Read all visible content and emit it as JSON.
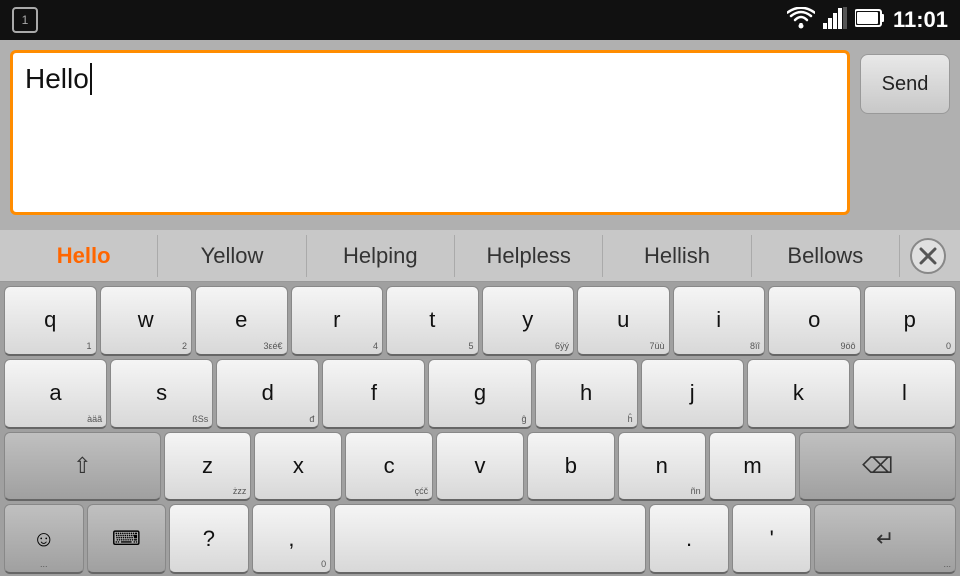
{
  "status_bar": {
    "notification": "1",
    "time": "11:01"
  },
  "message_area": {
    "input_text": "Hello",
    "send_button_label": "Send"
  },
  "suggestions": [
    {
      "label": "Hello",
      "active": true
    },
    {
      "label": "Yellow",
      "active": false
    },
    {
      "label": "Helping",
      "active": false
    },
    {
      "label": "Helpless",
      "active": false
    },
    {
      "label": "Hellish",
      "active": false
    },
    {
      "label": "Bellows",
      "active": false
    }
  ],
  "keyboard": {
    "rows": [
      [
        {
          "main": "q",
          "sub": "1"
        },
        {
          "main": "w",
          "sub": "2"
        },
        {
          "main": "e",
          "sub": "3εé€"
        },
        {
          "main": "r",
          "sub": "4"
        },
        {
          "main": "t",
          "sub": "5"
        },
        {
          "main": "y",
          "sub": "6ÿý"
        },
        {
          "main": "u",
          "sub": "7üù"
        },
        {
          "main": "i",
          "sub": "8ïî"
        },
        {
          "main": "o",
          "sub": "9öô"
        },
        {
          "main": "p",
          "sub": "0"
        }
      ],
      [
        {
          "main": "a",
          "sub": "àäã"
        },
        {
          "main": "s",
          "sub": "ßSs"
        },
        {
          "main": "d",
          "sub": "đ"
        },
        {
          "main": "f",
          "sub": ""
        },
        {
          "main": "g",
          "sub": "ĝ"
        },
        {
          "main": "h",
          "sub": "ĥ"
        },
        {
          "main": "j",
          "sub": ""
        },
        {
          "main": "k",
          "sub": ""
        },
        {
          "main": "l",
          "sub": ""
        }
      ],
      [
        {
          "main": "shift",
          "sub": ""
        },
        {
          "main": "z",
          "sub": "żzz"
        },
        {
          "main": "x",
          "sub": ""
        },
        {
          "main": "c",
          "sub": "çćč"
        },
        {
          "main": "v",
          "sub": ""
        },
        {
          "main": "b",
          "sub": ""
        },
        {
          "main": "n",
          "sub": "ññ"
        },
        {
          "main": "m",
          "sub": ""
        },
        {
          "main": "backspace",
          "sub": ""
        }
      ],
      [
        {
          "main": "emoji",
          "sub": "..."
        },
        {
          "main": "keyboard",
          "sub": ""
        },
        {
          "main": "?",
          "sub": ""
        },
        {
          "main": ",",
          "sub": "0"
        },
        {
          "main": "space",
          "sub": ""
        },
        {
          "main": ".",
          "sub": ""
        },
        {
          "main": "'",
          "sub": ""
        },
        {
          "main": "enter",
          "sub": "..."
        }
      ]
    ]
  },
  "colors": {
    "accent": "#ff6600",
    "border_active": "#ff8c00",
    "key_bg": "#f5f5f5",
    "key_dark": "#c0c0c0",
    "keyboard_bg": "#a0a0a0"
  }
}
